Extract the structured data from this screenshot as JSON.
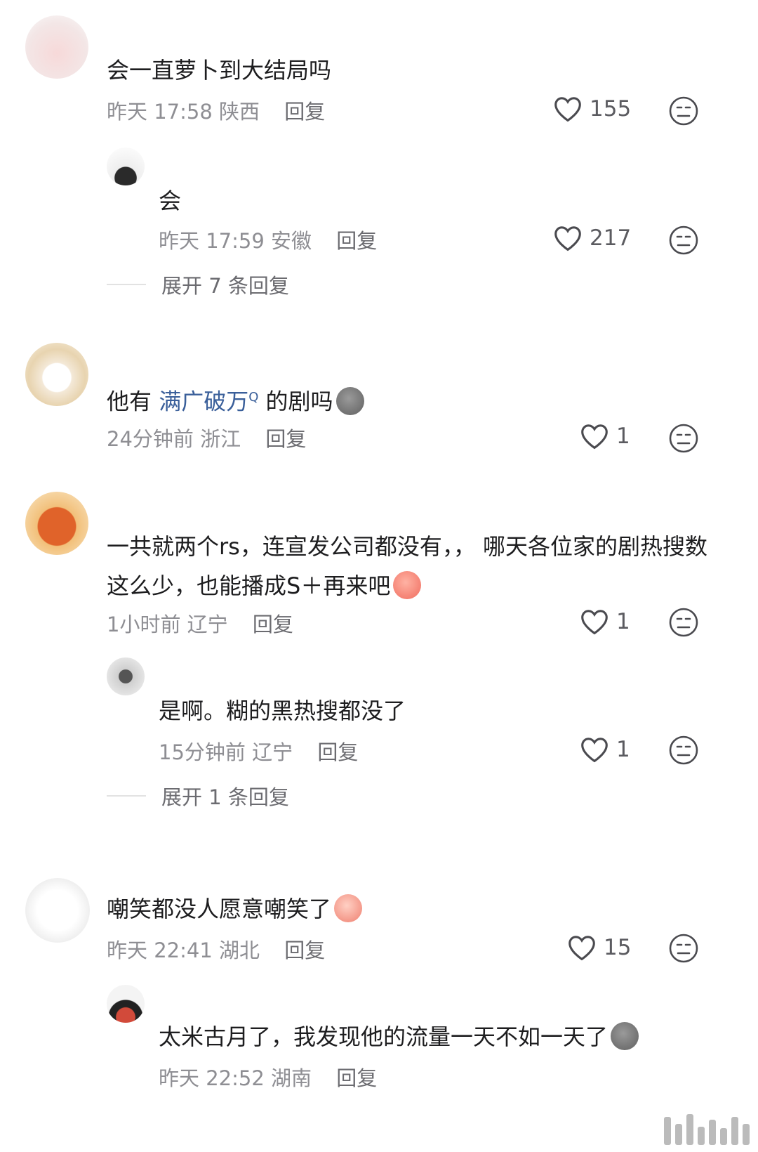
{
  "comments": [
    {
      "text": "会一直萝卜到大结局吗",
      "time": "昨天 17:58",
      "location": "陕西",
      "reply_label": "回复",
      "likes": "155"
    },
    {
      "text": "会",
      "time": "昨天 17:59",
      "location": "安徽",
      "reply_label": "回复",
      "likes": "217",
      "expand_label": "展开 7 条回复"
    },
    {
      "text_before": "他有 ",
      "hashtag": "满广破万",
      "text_after": " 的剧吗",
      "time": "24分钟前",
      "location": "浙江",
      "reply_label": "回复",
      "likes": "1"
    },
    {
      "text": "一共就两个rs，连宣发公司都没有，， 哪天各位家的剧热搜数这么少，也能播成S＋再来吧",
      "time": "1小时前",
      "location": "辽宁",
      "reply_label": "回复",
      "likes": "1"
    },
    {
      "text": "是啊。糊的黑热搜都没了",
      "time": "15分钟前",
      "location": "辽宁",
      "reply_label": "回复",
      "likes": "1",
      "expand_label": "展开 1 条回复"
    },
    {
      "text": "嘲笑都没人愿意嘲笑了",
      "time": "昨天 22:41",
      "location": "湖北",
      "reply_label": "回复",
      "likes": "15"
    },
    {
      "text": "太米古月了，我发现他的流量一天不如一天了",
      "time": "昨天 22:52",
      "location": "湖南",
      "reply_label": "回复"
    }
  ],
  "hashtag_suffix": "Q",
  "icons": {
    "like": "heart-outline-icon",
    "dislike": "neutral-face-icon"
  },
  "colors": {
    "hashtag": "#3a5f9a",
    "meta": "#8e8e93"
  }
}
